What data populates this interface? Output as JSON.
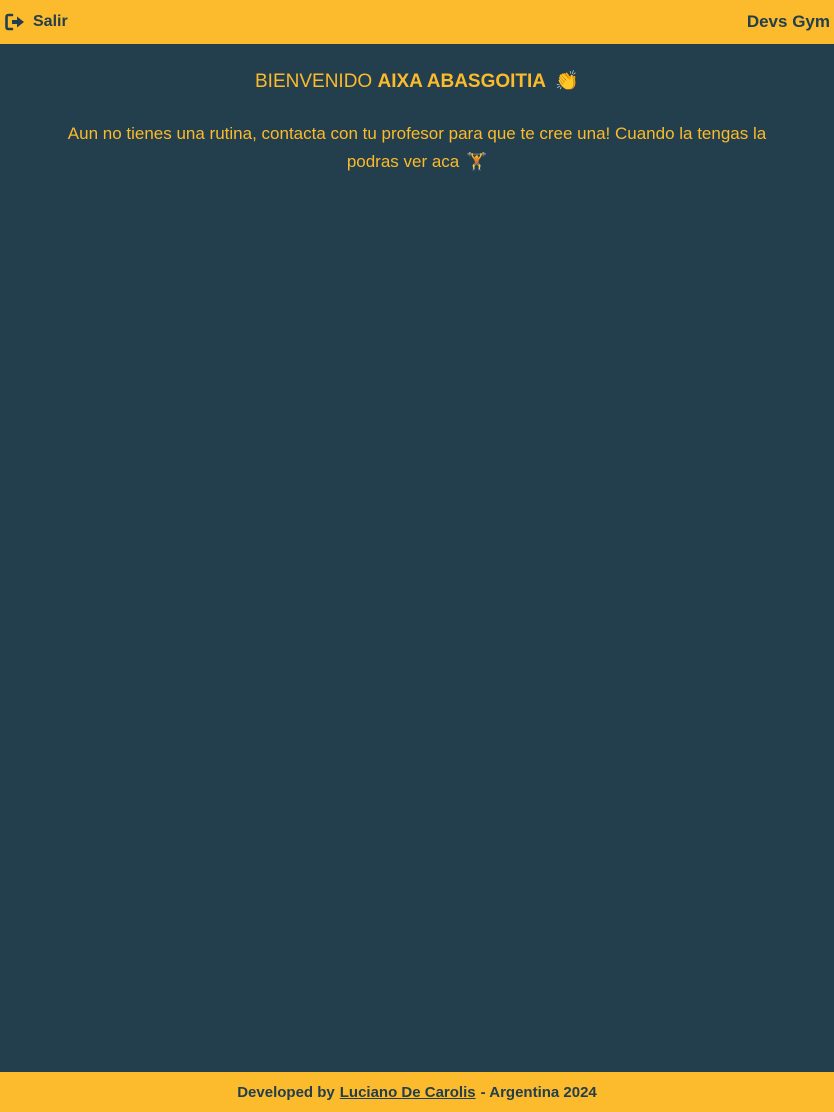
{
  "header": {
    "logout_label": "Salir",
    "logout_icon": "logout-icon",
    "brand": "Devs Gym"
  },
  "main": {
    "greeting_prefix": "BIENVENIDO",
    "user_name": "AIXA ABASGOITIA",
    "greeting_emoji": "👏",
    "no_routine_message": "Aun no tienes una rutina, contacta con tu profesor para que te cree una! Cuando la tengas la podras ver aca",
    "message_emoji": "🏋"
  },
  "footer": {
    "prefix": "Developed by",
    "author_link": "Luciano De Carolis",
    "suffix": "- Argentina 2024"
  },
  "colors": {
    "accent": "#fbbb2c",
    "background": "#233e4c"
  }
}
